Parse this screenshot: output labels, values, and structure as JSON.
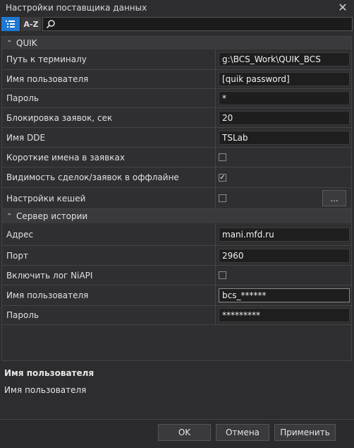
{
  "window": {
    "title": "Настройки поставщика данных"
  },
  "toolbar": {
    "az_label": "A-Z",
    "search_value": ""
  },
  "quik": {
    "label": "QUIK",
    "rows": [
      {
        "name": "Путь к терминалу",
        "value": "g:\\BCS_Work\\QUIK_BCS"
      },
      {
        "name": "Имя пользователя",
        "value": "[quik password]"
      },
      {
        "name": "Пароль",
        "value": "*"
      },
      {
        "name": "Блокировка заявок, сек",
        "value": "20"
      },
      {
        "name": "Имя DDE",
        "value": "TSLab"
      },
      {
        "name": "Короткие имена в заявках",
        "checked": false
      },
      {
        "name": "Видимость сделок/заявок в оффлайне",
        "checked": true
      },
      {
        "name": "Настройки кешей",
        "checked": false,
        "button": "..."
      }
    ]
  },
  "history": {
    "label": "Сервер истории",
    "rows": [
      {
        "name": "Адрес",
        "value": "mani.mfd.ru"
      },
      {
        "name": "Порт",
        "value": "2960"
      },
      {
        "name": "Включить лог NiAPI",
        "checked": false
      },
      {
        "name": "Имя пользователя",
        "value": "bcs_******"
      },
      {
        "name": "Пароль",
        "value": "*********"
      }
    ]
  },
  "description": {
    "title": "Имя пользователя",
    "text": "Имя пользователя"
  },
  "buttons": {
    "ok": "OK",
    "cancel": "Отмена",
    "apply": "Применить"
  }
}
